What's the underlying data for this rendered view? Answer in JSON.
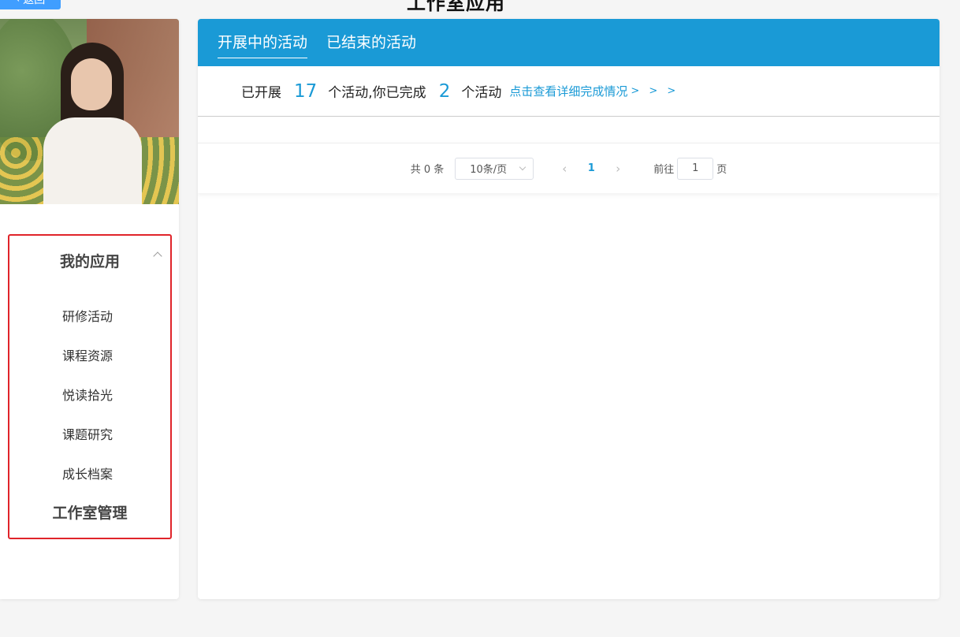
{
  "header": {
    "back_label": "返回",
    "title": "工作室应用"
  },
  "sidebar": {
    "menu_title": "我的应用",
    "items": [
      {
        "label": "研修活动"
      },
      {
        "label": "课程资源"
      },
      {
        "label": "悦读拾光"
      },
      {
        "label": "课题研究"
      },
      {
        "label": "成长档案"
      }
    ],
    "footer_title": "工作室管理"
  },
  "tabs": [
    {
      "label": "开展中的活动",
      "active": true
    },
    {
      "label": "已结束的活动",
      "active": false
    }
  ],
  "summary": {
    "prefix": "已开展",
    "activity_count": "17",
    "middle": "个活动,你已完成",
    "completed_count": "2",
    "suffix": "个活动",
    "detail_link": "点击查看详细完成情况",
    "arrows": "> > >"
  },
  "pagination": {
    "total": "共 0 条",
    "page_size": "10条/页",
    "current_page": "1",
    "goto_prefix": "前往",
    "goto_value": "1",
    "goto_suffix": "页"
  },
  "colors": {
    "accent": "#1a9ad6",
    "back_button": "#409eff",
    "highlight_border": "#e0242a"
  }
}
